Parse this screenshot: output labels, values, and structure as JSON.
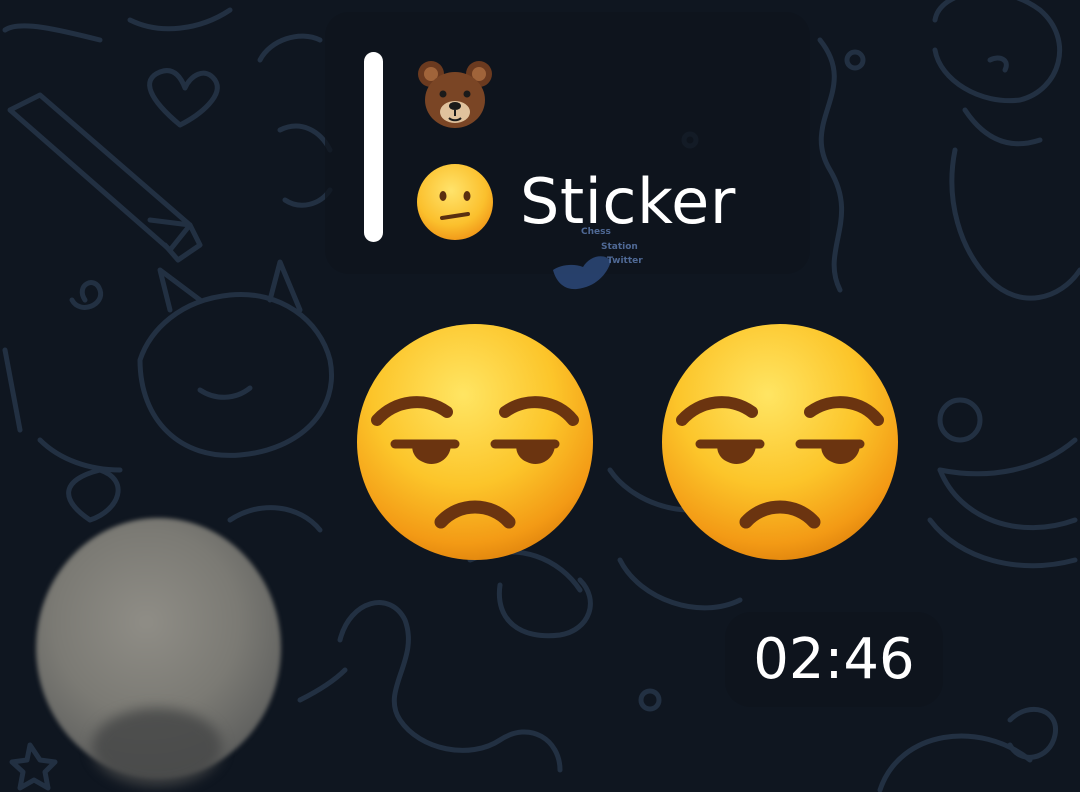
{
  "chat": {
    "reply_preview": {
      "bear_icon": "bear-face-emoji",
      "face_icon": "confused-face-emoji",
      "label": "Sticker"
    },
    "stickers": [
      {
        "icon": "unamused-face-emoji"
      },
      {
        "icon": "unamused-face-emoji"
      }
    ],
    "timestamp": "02:46",
    "watermark_lines": [
      "Chess",
      "Station",
      "Twitter"
    ]
  },
  "colors": {
    "background": "#0f1620",
    "doodle_stroke": "#223042",
    "bubble": "#0e131c",
    "reply_bar": "#ffffff",
    "text": "#ffffff",
    "emoji_yellow": "#fbc02d",
    "emoji_feature": "#7a3b10"
  }
}
